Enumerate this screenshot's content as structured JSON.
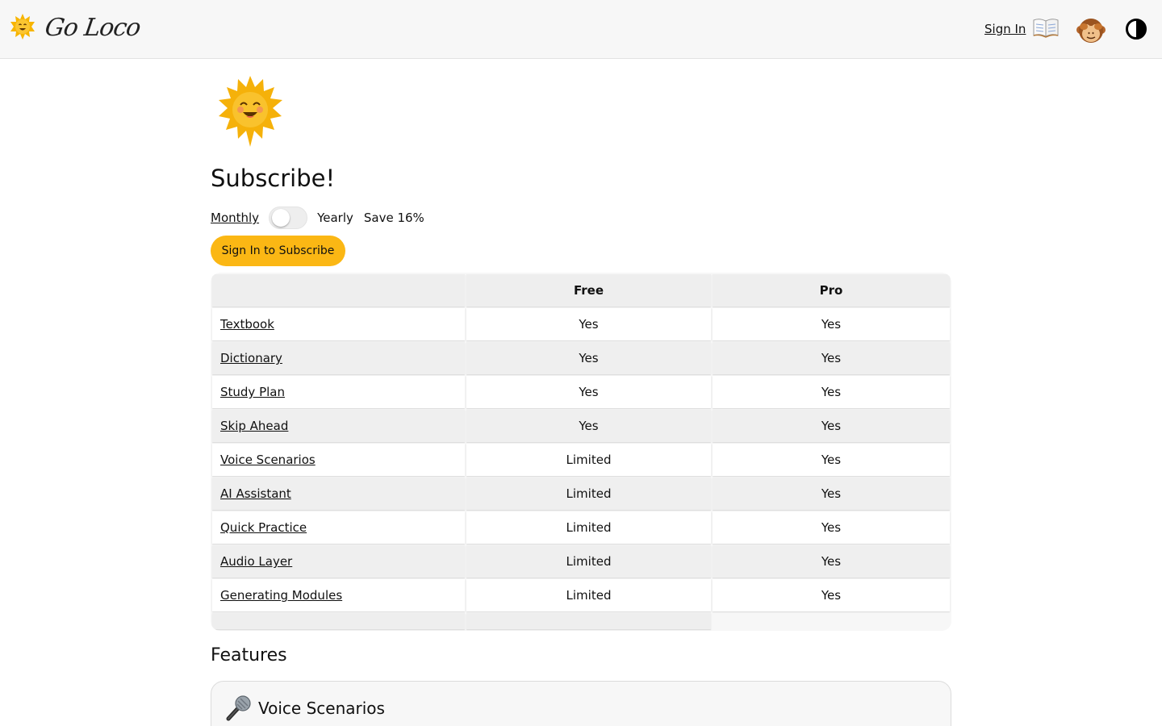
{
  "header": {
    "brand_name": "Go Loco",
    "signin_label": "Sign In"
  },
  "icons": {
    "logo": "sun-icon",
    "dictionary": "book-icon",
    "avatar": "monkey-icon",
    "theme": "contrast-icon",
    "hero": "sun-icon",
    "voice": "microphone-icon"
  },
  "colors": {
    "accent": "#fbb714",
    "header_bg": "#f7f7f7",
    "row_alt": "#efefef"
  },
  "subscribe": {
    "title": "Subscribe!",
    "monthly_label": "Monthly",
    "yearly_label": "Yearly",
    "savings_label": "Save 16%",
    "yearly_selected": false,
    "cta_label": "Sign In to Subscribe"
  },
  "plans": {
    "columns": [
      "",
      "Free",
      "Pro"
    ],
    "rows": [
      {
        "feature": "Textbook",
        "free": "Yes",
        "pro": "Yes"
      },
      {
        "feature": "Dictionary",
        "free": "Yes",
        "pro": "Yes"
      },
      {
        "feature": "Study Plan",
        "free": "Yes",
        "pro": "Yes"
      },
      {
        "feature": "Skip Ahead",
        "free": "Yes",
        "pro": "Yes"
      },
      {
        "feature": "Voice Scenarios",
        "free": "Limited",
        "pro": "Yes"
      },
      {
        "feature": "AI Assistant",
        "free": "Limited",
        "pro": "Yes"
      },
      {
        "feature": "Quick Practice",
        "free": "Limited",
        "pro": "Yes"
      },
      {
        "feature": "Audio Layer",
        "free": "Limited",
        "pro": "Yes"
      },
      {
        "feature": "Generating Modules",
        "free": "Limited",
        "pro": "Yes"
      }
    ]
  },
  "features": {
    "title": "Features",
    "cards": [
      {
        "title": "Voice Scenarios"
      }
    ]
  }
}
